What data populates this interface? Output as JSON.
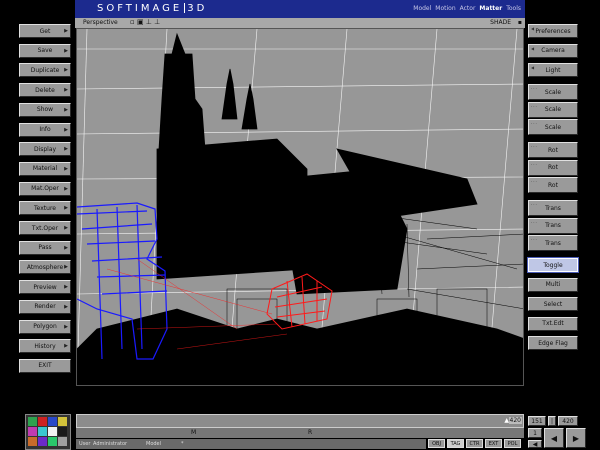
{
  "title_bar": {
    "logo_left": "SOFTIMAGE",
    "logo_right": "3D",
    "modules": [
      "Model",
      "Motion",
      "Actor",
      "Matter",
      "Tools"
    ],
    "active_module": "Matter"
  },
  "viewport_header": {
    "view_name": "Perspective",
    "mode": "SHADE"
  },
  "left_menu": {
    "items": [
      "Get",
      "Save",
      "Duplicate",
      "Delete",
      "Show",
      "Info",
      "Display",
      "Material",
      "Mat.Oper",
      "Texture",
      "Txt.Oper",
      "Pass",
      "Atmosphere",
      "Preview",
      "Render",
      "Polygon",
      "History",
      "EXIT"
    ]
  },
  "right_menu": {
    "top": [
      "Preferences",
      "Camera",
      "Light"
    ],
    "transforms": [
      [
        "Scale",
        "Scale",
        "Scale"
      ],
      [
        "Rot",
        "Rot",
        "Rot"
      ],
      [
        "Trans",
        "Trans",
        "Trans"
      ]
    ],
    "bottom": [
      "Toggle",
      "Multi",
      "Select",
      "Txt.Edt",
      "Edge Flag"
    ],
    "active": "Toggle"
  },
  "timeline": {
    "labels": [
      "M",
      "R"
    ],
    "frame": "420",
    "start_frame": "151",
    "end_frame": "420",
    "current": "1"
  },
  "status": {
    "user_label": "User",
    "user": "Administrator",
    "mode_label": "Model",
    "mode_value": "*"
  },
  "mode_buttons": [
    "OBJ",
    "TAG",
    "CTR",
    "EXT",
    "POL"
  ],
  "palette_colors": [
    "#2ea24f",
    "#cc2222",
    "#2a49c8",
    "#d2c23b",
    "#c03bb1",
    "#3bc7cf",
    "#f2f2f2",
    "#1a1a1a",
    "#c86b2a",
    "#6b2ac8",
    "#2ac86b",
    "#a0a0a0"
  ],
  "colors": {
    "title_bg": "#1c2a8e",
    "active_module": "#ffffff",
    "wire_red": "#ff1a1a",
    "wire_blue": "#1a1aff",
    "wire_black": "#000000"
  }
}
